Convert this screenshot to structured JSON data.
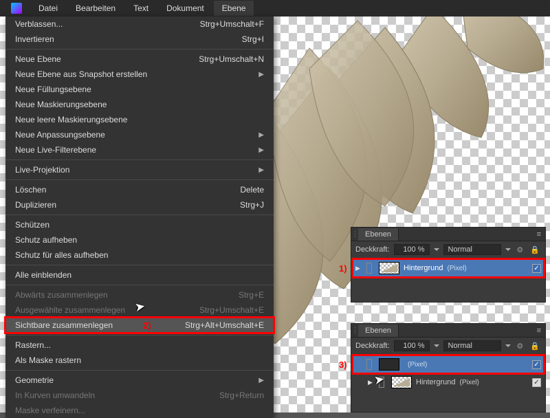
{
  "menubar": {
    "items": [
      "Datei",
      "Bearbeiten",
      "Text",
      "Dokument",
      "Ebene"
    ],
    "open_index": 4
  },
  "dropdown": [
    {
      "label": "Verblassen...",
      "shortcut": "Strg+Umschalt+F"
    },
    {
      "label": "Invertieren",
      "shortcut": "Strg+I"
    },
    {
      "sep": true
    },
    {
      "label": "Neue Ebene",
      "shortcut": "Strg+Umschalt+N"
    },
    {
      "label": "Neue Ebene aus Snapshot erstellen",
      "submenu": true
    },
    {
      "label": "Neue Füllungsebene"
    },
    {
      "label": "Neue Maskierungsebene"
    },
    {
      "label": "Neue leere Maskierungsebene"
    },
    {
      "label": "Neue Anpassungsebene",
      "submenu": true
    },
    {
      "label": "Neue Live-Filterebene",
      "submenu": true
    },
    {
      "sep": true
    },
    {
      "label": "Live-Projektion",
      "submenu": true
    },
    {
      "sep": true
    },
    {
      "label": "Löschen",
      "shortcut": "Delete"
    },
    {
      "label": "Duplizieren",
      "shortcut": "Strg+J"
    },
    {
      "sep": true
    },
    {
      "label": "Schützen"
    },
    {
      "label": "Schutz aufheben"
    },
    {
      "label": "Schutz für alles aufheben"
    },
    {
      "sep": true
    },
    {
      "label": "Alle einblenden"
    },
    {
      "sep": true
    },
    {
      "label": "Abwärts zusammenlegen",
      "shortcut": "Strg+E",
      "disabled": true
    },
    {
      "label": "Ausgewählte zusammenlegen",
      "shortcut": "Strg+Umschalt+E",
      "disabled": true
    },
    {
      "label": "Sichtbare zusammenlegen",
      "shortcut": "Strg+Alt+Umschalt+E",
      "highlight": true,
      "annotation": "2)"
    },
    {
      "sep": true
    },
    {
      "label": "Rastern..."
    },
    {
      "label": "Als Maske rastern"
    },
    {
      "sep": true
    },
    {
      "label": "Geometrie",
      "submenu": true
    },
    {
      "label": "In Kurven umwandeln",
      "shortcut": "Strg+Return",
      "disabled": true
    },
    {
      "label": "Maske verfeinern...",
      "disabled": true
    }
  ],
  "panels": {
    "tab_label": "Ebenen",
    "opacity_label": "Deckkraft:",
    "opacity_value": "100 %",
    "blend_mode": "Normal"
  },
  "layers_top": [
    {
      "name": "Hintergrund",
      "type": "(Pixel)",
      "selected": true,
      "disclose": true,
      "annotation": "1)"
    }
  ],
  "layers_bot": [
    {
      "name": "",
      "type": "(Pixel)",
      "selected": true,
      "dark": true,
      "annotation": "3)"
    },
    {
      "name": "Hintergrund",
      "type": "(Pixel)",
      "selected": false,
      "disclose": true
    }
  ]
}
